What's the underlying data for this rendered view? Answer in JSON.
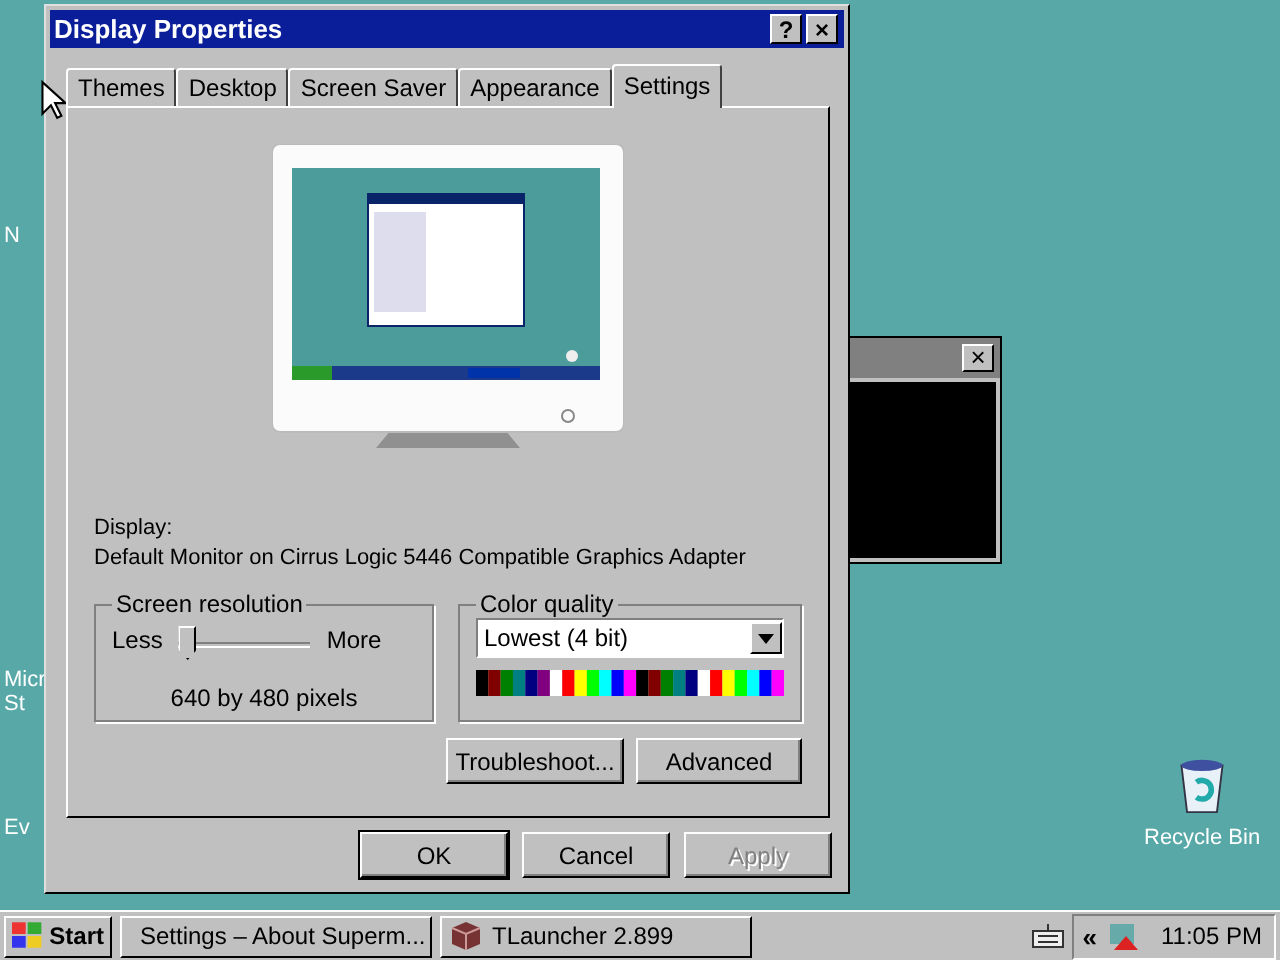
{
  "desktop": {
    "icon_labels": [
      "N",
      "Micr",
      "St",
      "Ev"
    ],
    "recycle_bin": "Recycle Bin"
  },
  "window": {
    "title": "Display Properties",
    "help_button": "?",
    "close_button": "×"
  },
  "tabs": [
    {
      "label": "Themes",
      "selected": false
    },
    {
      "label": "Desktop",
      "selected": false
    },
    {
      "label": "Screen Saver",
      "selected": false
    },
    {
      "label": "Appearance",
      "selected": false
    },
    {
      "label": "Settings",
      "selected": true
    }
  ],
  "display": {
    "label": "Display:",
    "value": "Default Monitor on Cirrus Logic 5446 Compatible Graphics Adapter"
  },
  "resolution": {
    "title": "Screen resolution",
    "less": "Less",
    "more": "More",
    "level": 0,
    "reading": "640 by 480 pixels"
  },
  "color_quality": {
    "title": "Color quality",
    "value": "Lowest (4 bit)"
  },
  "panel_buttons": [
    {
      "label": "Troubleshoot...",
      "disabled": false
    },
    {
      "label": "Advanced",
      "disabled": false
    }
  ],
  "dialog_buttons": [
    {
      "label": "OK",
      "disabled": false,
      "default": true
    },
    {
      "label": "Cancel",
      "disabled": false,
      "default": false
    },
    {
      "label": "Apply",
      "disabled": true,
      "default": false
    }
  ],
  "background_window": {
    "close_button": "×"
  },
  "taskbar": {
    "start": "Start",
    "tasks": [
      {
        "label": "Settings – About Superm...",
        "kind": "settings"
      },
      {
        "label": "TLauncher 2.899",
        "kind": "launcher"
      }
    ],
    "tray_arrow": "«",
    "clock": "11:05 PM"
  }
}
